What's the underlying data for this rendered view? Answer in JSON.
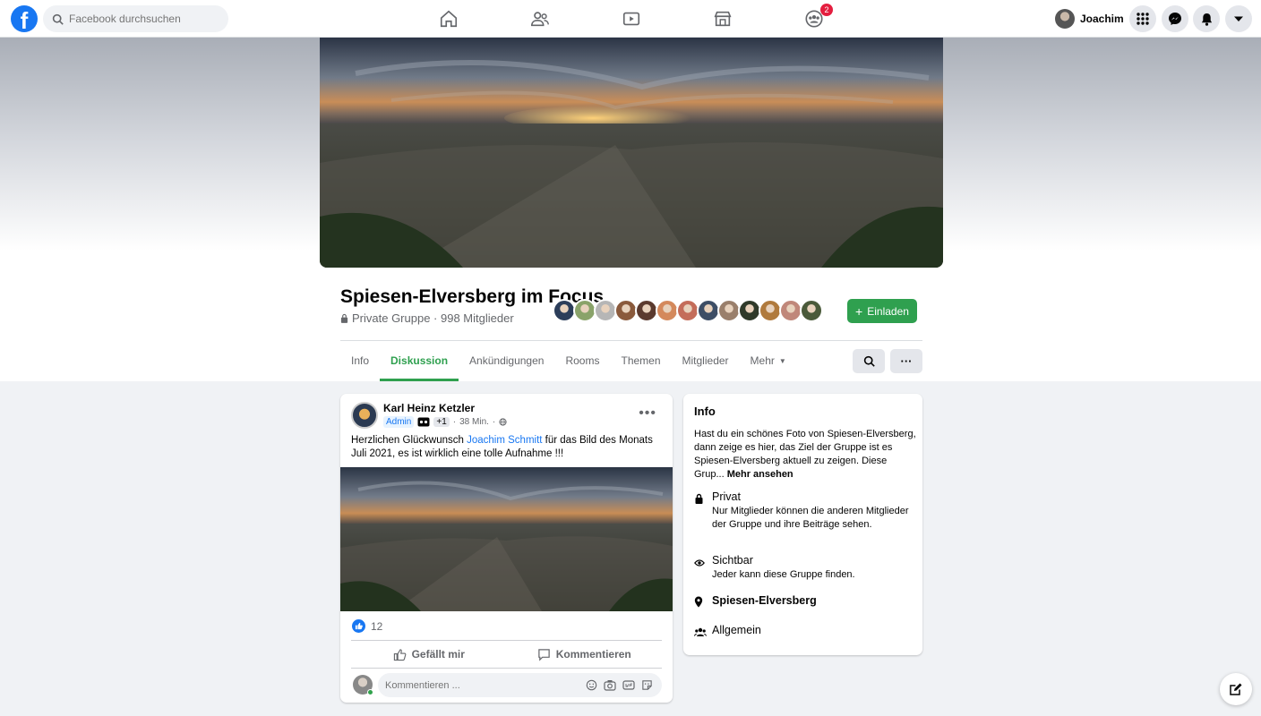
{
  "topbar": {
    "logo_glyph": "f",
    "search_placeholder": "Facebook durchsuchen",
    "nav_icons": [
      "home-icon",
      "friends-icon",
      "watch-icon",
      "marketplace-icon",
      "groups-icon"
    ],
    "groups_badge": "2",
    "user_name": "Joachim",
    "right_icons": [
      "menu-grid-icon",
      "messenger-icon",
      "notifications-icon",
      "account-dropdown-icon"
    ]
  },
  "group": {
    "name": "Spiesen-Elversberg im Focus",
    "meta": "Private Gruppe · 998 Mitglieder",
    "invite_label": "Einladen",
    "member_avatar_count": 13
  },
  "tabs": [
    "Info",
    "Diskussion",
    "Ankündigungen",
    "Rooms",
    "Themen",
    "Mitglieder",
    "Mehr"
  ],
  "active_tab": "Diskussion",
  "post": {
    "author": "Karl Heinz Ketzler",
    "admin_label": "Admin",
    "plus_label": "+1",
    "time": "38 Min.",
    "text_before": "Herzlichen Glückwunsch ",
    "mention": "Joachim Schmitt",
    "text_after": " für das Bild des Monats Juli 2021, es ist wirklich eine tolle Aufnahme !!!",
    "like_count": "12",
    "like_label": "Gefällt mir",
    "comment_label": "Kommentieren",
    "comment_placeholder": "Kommentieren ..."
  },
  "info": {
    "title": "Info",
    "description": "Hast du ein schönes Foto von Spiesen-Elversberg, dann zeige es hier, das Ziel der Gruppe ist es Spiesen-Elversberg aktuell zu zeigen. Diese Grup...",
    "more_label": "Mehr ansehen",
    "private_title": "Privat",
    "private_desc": "Nur Mitglieder können die anderen Mitglieder der Gruppe und ihre Beiträge sehen.",
    "visible_title": "Sichtbar",
    "visible_desc": "Jeder kann diese Gruppe finden.",
    "location": "Spiesen-Elversberg",
    "category": "Allgemein"
  },
  "colors": {
    "brand": "#1877f2",
    "group_accent": "#2fa04f",
    "badge": "#e41e3f"
  }
}
